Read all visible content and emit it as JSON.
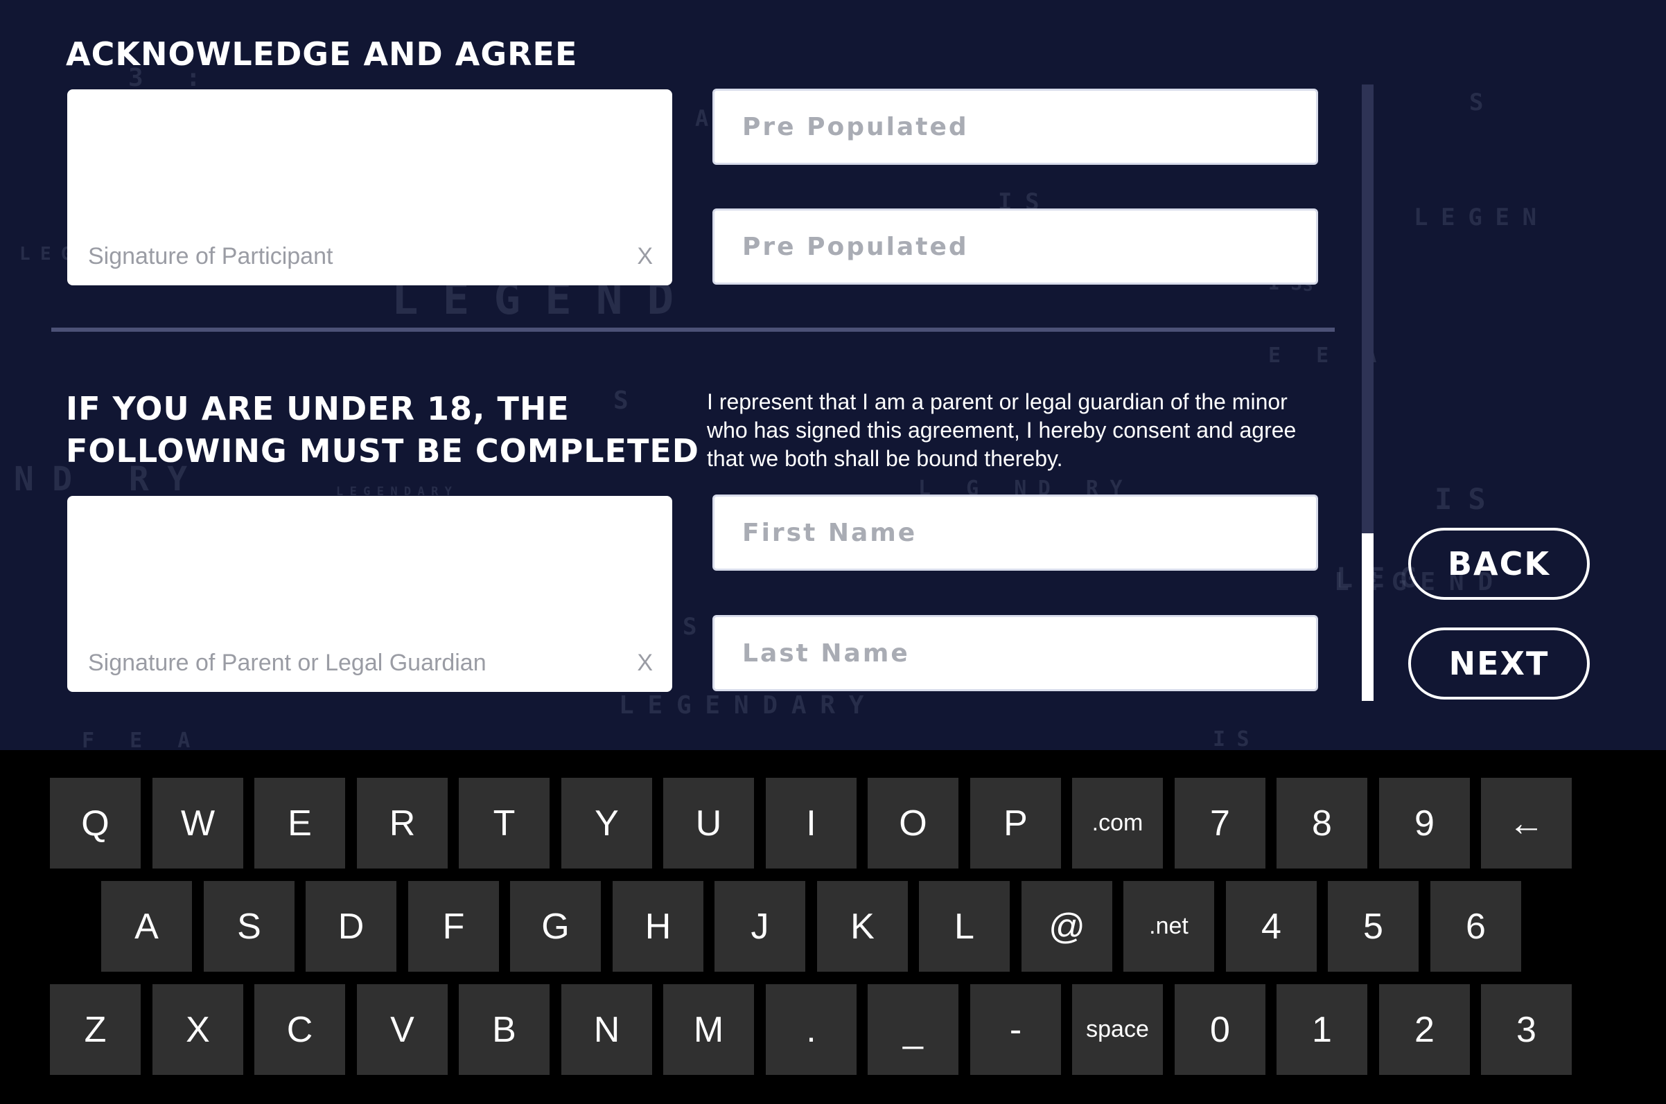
{
  "ack_section": {
    "heading": "ACKNOWLEDGE AND AGREE",
    "participant_signature": {
      "label": "Signature of Participant",
      "clear": "X"
    },
    "field_1": {
      "placeholder": "Pre Populated"
    },
    "field_2": {
      "placeholder": "Pre Populated"
    }
  },
  "minor_section": {
    "heading_line1": "IF YOU ARE UNDER 18, THE",
    "heading_line2": "FOLLOWING  MUST BE COMPLETED",
    "consent_text": "I represent that I am a parent or legal guardian of the minor who has signed this agreement, I hereby consent and agree that we both shall be bound thereby.",
    "guardian_signature": {
      "label": "Signature of Parent or Legal Guardian",
      "clear": "X"
    },
    "first_name": {
      "placeholder": "First Name"
    },
    "last_name": {
      "placeholder": "Last Name"
    }
  },
  "nav": {
    "back_label": "BACK",
    "next_label": "NEXT"
  },
  "scrollbar": {
    "position": 0.75
  },
  "keyboard": {
    "rows": [
      [
        "Q",
        "W",
        "E",
        "R",
        "T",
        "Y",
        "U",
        "I",
        "O",
        "P",
        ".com",
        "7",
        "8",
        "9",
        "←"
      ],
      [
        "A",
        "S",
        "D",
        "F",
        "G",
        "H",
        "J",
        "K",
        "L",
        "@",
        ".net",
        "4",
        "5",
        "6"
      ],
      [
        "Z",
        "X",
        "C",
        "V",
        "B",
        "N",
        "M",
        ".",
        "_",
        "-",
        "space",
        "0",
        "1",
        "2",
        "3"
      ]
    ]
  },
  "background_words": [
    "LEGEND",
    "LEGENDARY",
    "LEGENDARY",
    "LEGEND",
    "LEGEN",
    "LEGEND",
    "ND RY",
    "L G ND RY",
    "IS",
    "IS",
    "IS",
    "IS",
    "E E A",
    "F E A",
    "S",
    "S",
    "S",
    "A",
    "S",
    "LEG",
    "3 :"
  ],
  "colors": {
    "background": "#111633",
    "keyboard_bg": "#000000",
    "key_bg": "#303030",
    "accent": "#ffffff"
  }
}
